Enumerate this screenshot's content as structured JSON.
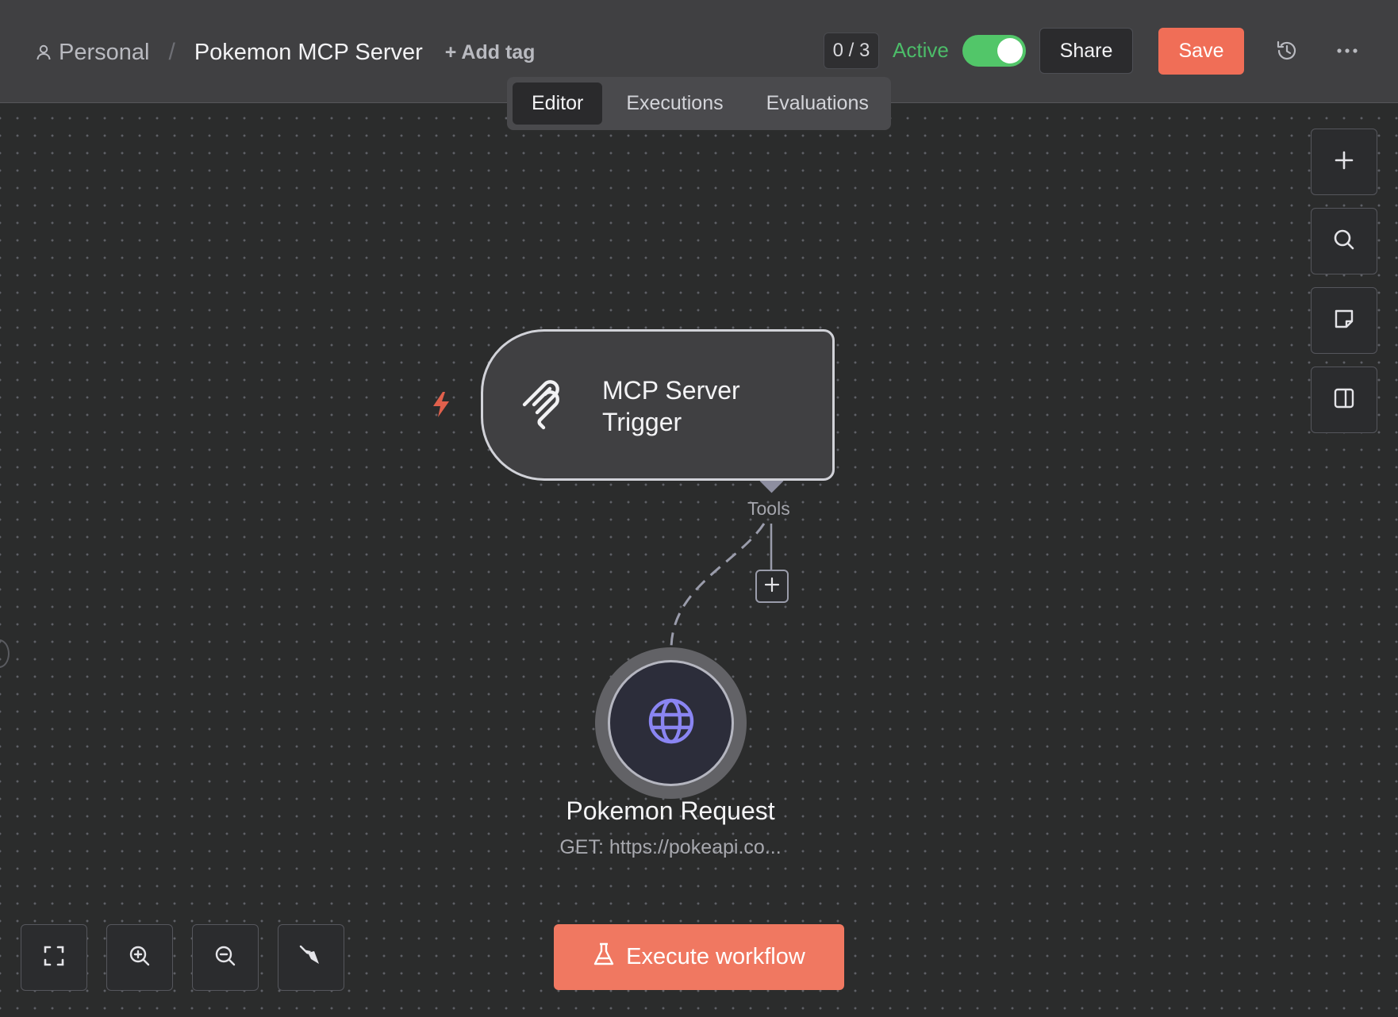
{
  "header": {
    "breadcrumb": {
      "project": "Personal",
      "separator": "/",
      "workflow_name": "Pokemon MCP Server"
    },
    "add_tag_label": "+ Add tag",
    "counter": "0 / 3",
    "active_label": "Active",
    "active_state": true,
    "share_label": "Share",
    "save_label": "Save",
    "history_icon": "history-icon",
    "more_icon": "ellipsis-icon"
  },
  "tabs": [
    {
      "label": "Editor",
      "active": true
    },
    {
      "label": "Executions",
      "active": false
    },
    {
      "label": "Evaluations",
      "active": false
    }
  ],
  "side_toolbar": [
    {
      "icon": "plus-icon",
      "name": "add-node"
    },
    {
      "icon": "search-icon",
      "name": "search"
    },
    {
      "icon": "sticky-note-icon",
      "name": "add-sticky"
    },
    {
      "icon": "panel-icon",
      "name": "toggle-panel"
    }
  ],
  "nodes": {
    "trigger": {
      "label": "MCP Server Trigger",
      "icon": "mcp-icon"
    },
    "connection_label": "Tools",
    "request": {
      "label": "Pokemon Request",
      "subtitle": "GET: https://pokeapi.co...",
      "icon": "globe-icon"
    }
  },
  "bottom_toolbar": [
    {
      "icon": "fit-view-icon"
    },
    {
      "icon": "zoom-in-icon"
    },
    {
      "icon": "zoom-out-icon"
    },
    {
      "icon": "tidy-up-icon"
    }
  ],
  "execute_button": {
    "label": "Execute workflow",
    "icon": "flask-icon"
  },
  "colors": {
    "accent": "#f06e57",
    "active_green": "#52c669",
    "globe": "#8a85f2",
    "background": "#2b2c2c"
  }
}
